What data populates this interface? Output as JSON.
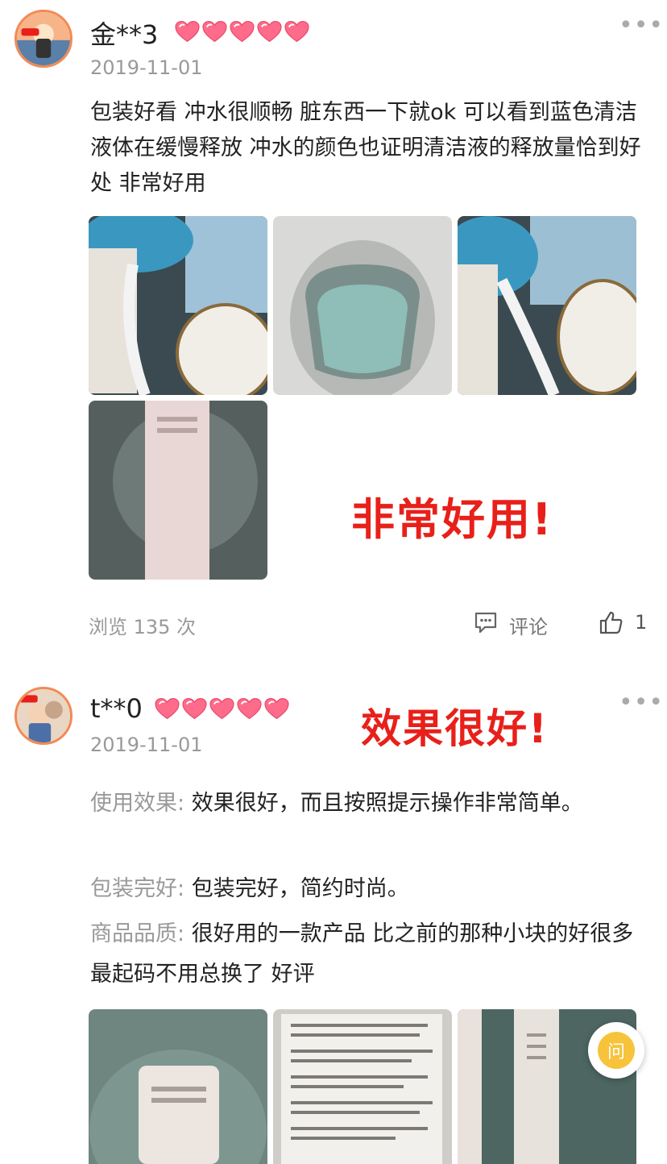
{
  "review1": {
    "username": "金**3",
    "date": "2019-11-01",
    "more": "•••",
    "hearts": 5,
    "text": "包装好看 冲水很顺畅 脏东西一下就ok 可以看到蓝色清洁液体在缓慢释放 冲水的颜色也证明清洁液的释放量恰到好处 非常好用",
    "overlay": "非常好用!",
    "views": "浏览 135 次",
    "comment_label": "评论",
    "like_count": "1"
  },
  "review2": {
    "username": "t**0",
    "date": "2019-11-01",
    "more": "•••",
    "hearts": 5,
    "overlay": "效果很好!",
    "fields": [
      {
        "label": "使用效果:",
        "value": "效果很好，而且按照提示操作非常简单。"
      },
      {
        "label": "包装完好:",
        "value": "包装完好，简约时尚。"
      },
      {
        "label": "商品品质:",
        "value": "很好用的一款产品 比之前的那种小块的好很多 最起码不用总换了 好评"
      }
    ]
  },
  "ask_button": "问",
  "icons": {
    "heart": "heart-icon",
    "comment": "comment-icon",
    "like": "thumbs-up-icon",
    "more": "more-icon"
  },
  "colors": {
    "accent_red": "#e8201a",
    "muted": "#999999",
    "heart_pink": "#ff6b8a",
    "ask_yellow": "#f6c33b"
  }
}
